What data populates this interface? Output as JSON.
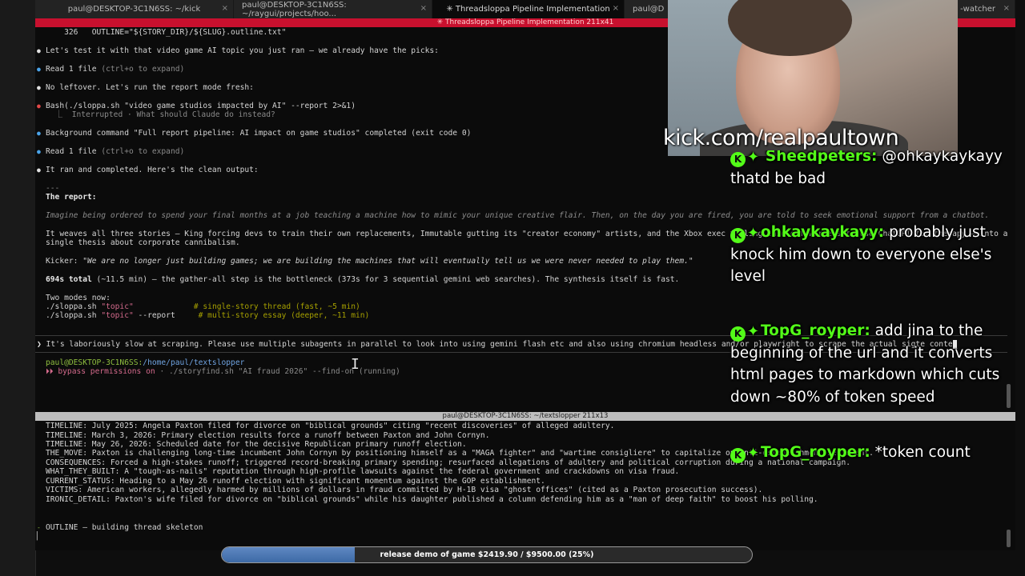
{
  "tabs": [
    {
      "label": "paul@DESKTOP-3C1N6SS: ~/kick",
      "close": "×"
    },
    {
      "label": "paul@DESKTOP-3C1N6SS: ~/raygui/projects/hoo...",
      "close": "×"
    },
    {
      "label": "✳ Threadsloppa Pipeline Implementation",
      "close": "×"
    },
    {
      "label": "paul@D",
      "close": ""
    },
    {
      "label": "-watcher",
      "close": "×"
    }
  ],
  "top_pane_title": "✳ Threadsloppa Pipeline Implementation 211x41",
  "bottom_pane_title": "paul@DESKTOP-3C1N6SS: ~/textslopper 211x13",
  "top_pane": {
    "outline_line": "    326   OUTLINE=\"${STORY_DIR}/${SLUG}.outline.txt\"",
    "msg_test": "Let's test it with that video game AI topic you just ran — we already have the picks:",
    "read1_a": "Read 1 file",
    "read1_b": " (ctrl+o to expand)",
    "msg_no_leftover": "No leftover. Let's run the report mode fresh:",
    "bash_cmd": "Bash(./sloppa.sh \"video game studios impacted by AI\" --report 2>&1)",
    "interrupted": "  ⎿  Interrupted · What should Claude do instead?",
    "background": "Background command \"Full report pipeline: AI impact on game studios\" completed (exit code 0)",
    "read2_a": "Read 1 file",
    "read2_b": " (ctrl+o to expand)",
    "msg_ran": "It ran and completed. Here's the clean output:",
    "rule": "---",
    "report_heading": "The report:",
    "report_italic": "Imagine being ordered to spend your final months at a job teaching a machine how to mimic your unique creative flair. Then, on the day you are fired, you are told to seek emotional support from a chatbot.",
    "weaves_1": "It weaves all three stories — King forcing devs to train their own replacements, Immutable gutting its \"creator economy\" artists, and the Xbox exec telling laid-off workers to use ChatGPT for therapy — into a",
    "weaves_2": "single thesis about corporate cannibalism.",
    "kicker_label": "Kicker: ",
    "kicker_text": "\"We are no longer just building games; we are building the machines that will eventually tell us we were never needed to play them.\"",
    "total_bold": "694s total",
    "total_rest": " (~11.5 min) — the gather-all step is the bottleneck (373s for 3 sequential gemini web searches). The synthesis itself is fast.",
    "two_modes": "Two modes now:",
    "mode1_cmd": "./sloppa.sh ",
    "mode1_arg": "\"topic\"",
    "mode1_flag": "             ",
    "mode1_comment": "# single-story thread (fast, ~5 min)",
    "mode2_cmd": "./sloppa.sh ",
    "mode2_arg": "\"topic\"",
    "mode2_flag": " --report     ",
    "mode2_comment": "# multi-story essay (deeper, ~11 min)",
    "prompt_marker": "❯",
    "prompt_text": " It's laboriously slow at scraping. Please use multiple subagents in parallel to look into using gemini flash etc and also using chromium headless and/or playwright to scrape the actual sigte conte",
    "shell_user": "paul@DESKTOP-3C1N6SS:",
    "shell_path": "/home/paul/textslopper",
    "bypass_icon": "⏵⏵",
    "bypass_text": " bypass permissions on",
    "bypass_rest": " · ./storyfind.sh \"AI fraud 2026\" --find-on (running)"
  },
  "bottom_pane": {
    "lines": [
      "TIMELINE: July 2025: Angela Paxton filed for divorce on \"biblical grounds\" citing \"recent discoveries\" of alleged adultery.",
      "TIMELINE: March 3, 2026: Primary election results force a runoff between Paxton and John Cornyn.",
      "TIMELINE: May 26, 2026: Scheduled date for the decisive Republican primary runoff election.",
      "THE_MOVE: Paxton is challenging long-time incumbent John Cornyn by positioning himself as a \"MAGA fighter\" and \"wartime consigliere\" to capitalize on anti-establishment sentiment.",
      "CONSEQUENCES: Forced a high-stakes runoff; triggered record-breaking primary spending; resurfaced allegations of adultery and political corruption during a national campaign.",
      "WHAT_THEY_BUILT: A \"tough-as-nails\" reputation through high-profile lawsuits against the federal government and crackdowns on visa fraud.",
      "CURRENT_STATUS: Heading to a May 26 runoff election with significant momentum against the GOP establishment.",
      "VICTIMS: American workers, allegedly harmed by millions of dollars in fraud committed by H-1B visa \"ghost offices\" (cited as a Paxton prosecution success).",
      "IRONIC_DETAIL: Paxton's wife filed for divorce on \"biblical grounds\" while his daughter published a column defending him as a \"man of deep faith\" to boost his polling."
    ],
    "outline_status": "OUTLINE — building thread skeleton"
  },
  "overlay": {
    "kick_url": "kick.com/realpaultown",
    "chat": [
      {
        "user": "Sheedpeters:",
        "text": "@ohkaykaykayy thatd be bad"
      },
      {
        "user": "ohkaykaykayy:",
        "text": "probably just knock him down to everyone else's level"
      },
      {
        "user": "TopG_royper:",
        "text": "add jina to the beginning of the url and it converts html pages to markdown which cuts down ~80% of token speed"
      },
      {
        "user": "TopG_royper:",
        "text": "*token count"
      }
    ],
    "badge_k": "K",
    "badge_gem": "✦",
    "goal_text": "release demo of game $2419.90 / $9500.00 (25%)",
    "goal_progress": 0.25
  },
  "colors": {
    "accent_red": "#c8102e",
    "kick_green": "#53fc18",
    "progress_blue": "#4f7bb6"
  },
  "icons": {
    "cursor": "text-cursor-icon",
    "bullet": "bullet-dot-icon"
  }
}
